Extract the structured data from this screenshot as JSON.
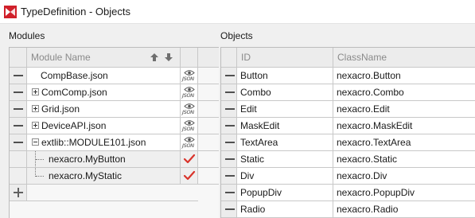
{
  "window": {
    "title": "TypeDefinition - Objects"
  },
  "modules": {
    "label": "Modules",
    "header": {
      "name": "Module Name"
    },
    "rows": [
      {
        "name": "CompBase.json",
        "state": "none",
        "icon": "eye-json-icon"
      },
      {
        "name": "ComComp.json",
        "state": "collapsed",
        "icon": "eye-json-icon"
      },
      {
        "name": "Grid.json",
        "state": "collapsed",
        "icon": "eye-json-icon"
      },
      {
        "name": "DeviceAPI.json",
        "state": "collapsed",
        "icon": "eye-json-icon"
      },
      {
        "name": "extlib::MODULE101.json",
        "state": "expanded",
        "icon": "eye-json-icon"
      },
      {
        "name": "nexacro.MyButton",
        "state": "child",
        "icon": "check-icon"
      },
      {
        "name": "nexacro.MyStatic",
        "state": "child",
        "icon": "check-icon"
      }
    ],
    "json_icon_label": "JSON",
    "check_color": "#d9342b"
  },
  "objects": {
    "label": "Objects",
    "header": {
      "id": "ID",
      "classname": "ClassName"
    },
    "rows": [
      {
        "id": "Button",
        "classname": "nexacro.Button"
      },
      {
        "id": "Combo",
        "classname": "nexacro.Combo"
      },
      {
        "id": "Edit",
        "classname": "nexacro.Edit"
      },
      {
        "id": "MaskEdit",
        "classname": "nexacro.MaskEdit"
      },
      {
        "id": "TextArea",
        "classname": "nexacro.TextArea"
      },
      {
        "id": "Static",
        "classname": "nexacro.Static"
      },
      {
        "id": "Div",
        "classname": "nexacro.Div"
      },
      {
        "id": "PopupDiv",
        "classname": "nexacro.PopupDiv"
      },
      {
        "id": "Radio",
        "classname": "nexacro.Radio"
      }
    ]
  }
}
